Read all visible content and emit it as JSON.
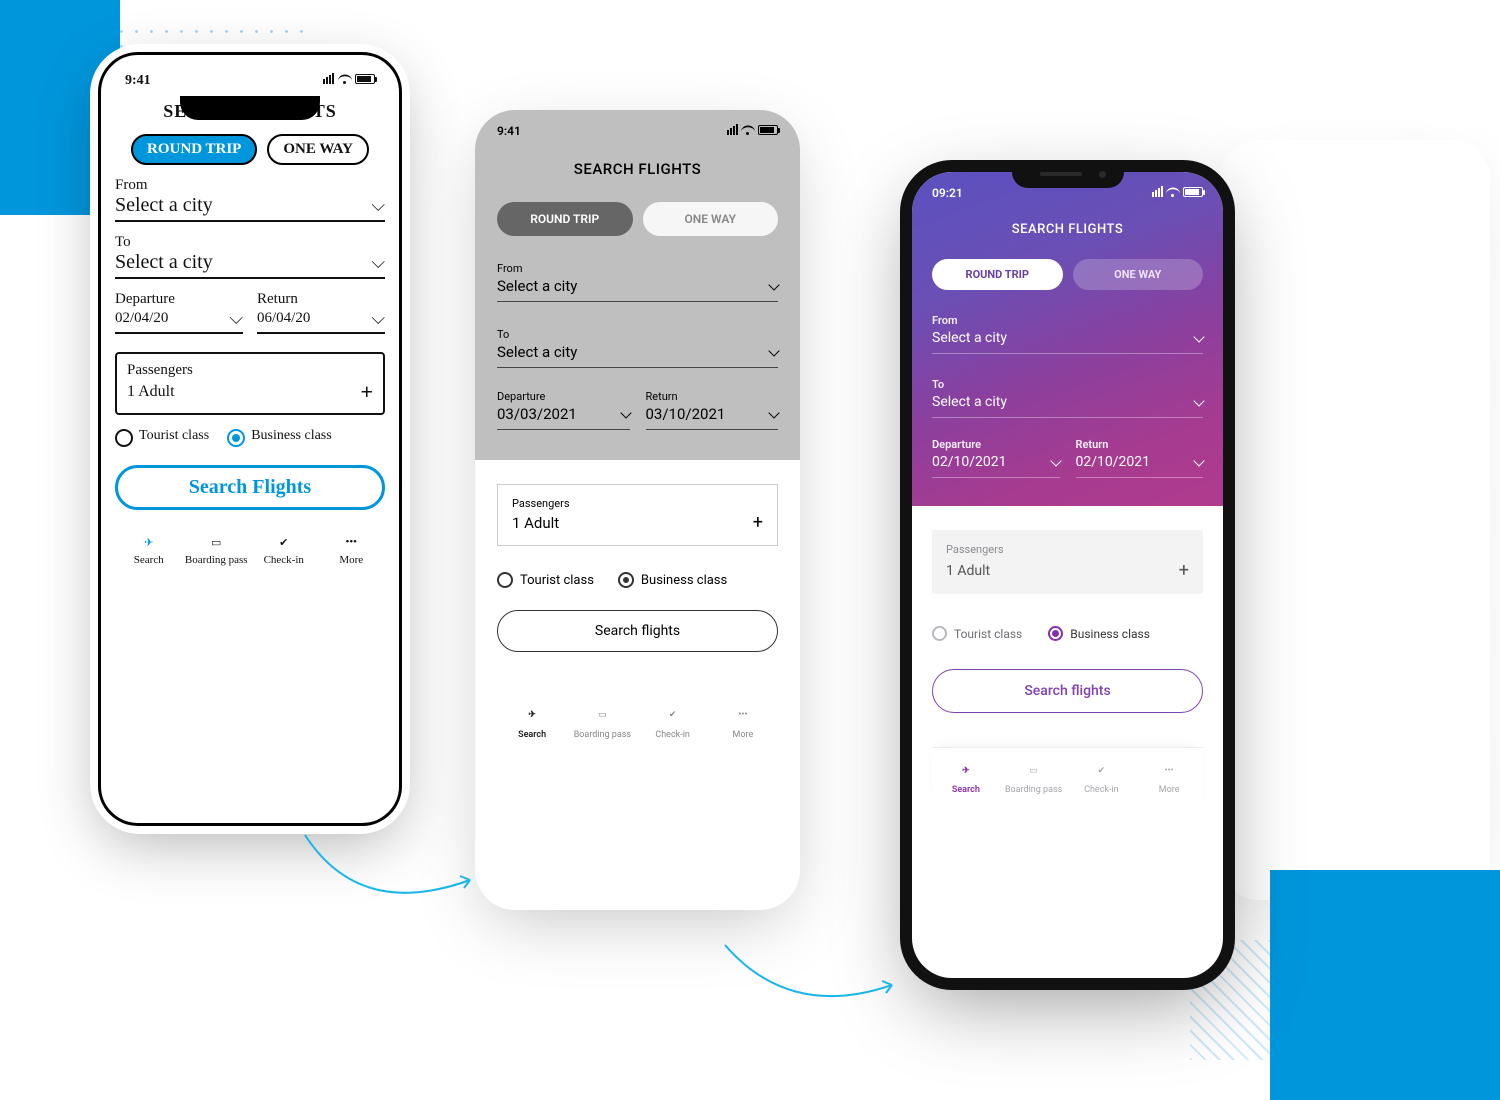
{
  "sketch": {
    "time": "9:41",
    "title": "SEARCH FLIGHTS",
    "trip_round": "ROUND TRIP",
    "trip_oneway": "ONE WAY",
    "from_label": "From",
    "from_value": "Select a city",
    "to_label": "To",
    "to_value": "Select a city",
    "departure_label": "Departure",
    "departure_value": "02/04/20",
    "return_label": "Return",
    "return_value": "06/04/20",
    "passengers_label": "Passengers",
    "passengers_value": "1 Adult",
    "plus": "+",
    "tourist": "Tourist class",
    "business": "Business class",
    "search_btn": "Search Flights",
    "nav": {
      "search": "Search",
      "boarding": "Boarding pass",
      "checkin": "Check-in",
      "more": "More"
    }
  },
  "wireframe": {
    "time": "9:41",
    "title": "SEARCH FLIGHTS",
    "trip_round": "ROUND TRIP",
    "trip_oneway": "ONE WAY",
    "from_label": "From",
    "from_value": "Select a city",
    "to_label": "To",
    "to_value": "Select a city",
    "departure_label": "Departure",
    "departure_value": "03/03/2021",
    "return_label": "Return",
    "return_value": "03/10/2021",
    "passengers_label": "Passengers",
    "passengers_value": "1 Adult",
    "plus": "+",
    "tourist": "Tourist class",
    "business": "Business class",
    "search_btn": "Search flights",
    "nav": {
      "search": "Search",
      "boarding": "Boarding pass",
      "checkin": "Check-in",
      "more": "More"
    }
  },
  "hifi": {
    "time": "09:21",
    "title": "SEARCH FLIGHTS",
    "trip_round": "ROUND TRIP",
    "trip_oneway": "ONE WAY",
    "from_label": "From",
    "from_value": "Select a city",
    "to_label": "To",
    "to_value": "Select a city",
    "departure_label": "Departure",
    "departure_value": "02/10/2021",
    "return_label": "Return",
    "return_value": "02/10/2021",
    "passengers_label": "Passengers",
    "passengers_value": "1 Adult",
    "plus": "+",
    "tourist": "Tourist class",
    "business": "Business class",
    "search_btn": "Search flights",
    "nav": {
      "search": "Search",
      "boarding": "Boarding pass",
      "checkin": "Check-in",
      "more": "More"
    },
    "accent": "#8a2ea9"
  }
}
